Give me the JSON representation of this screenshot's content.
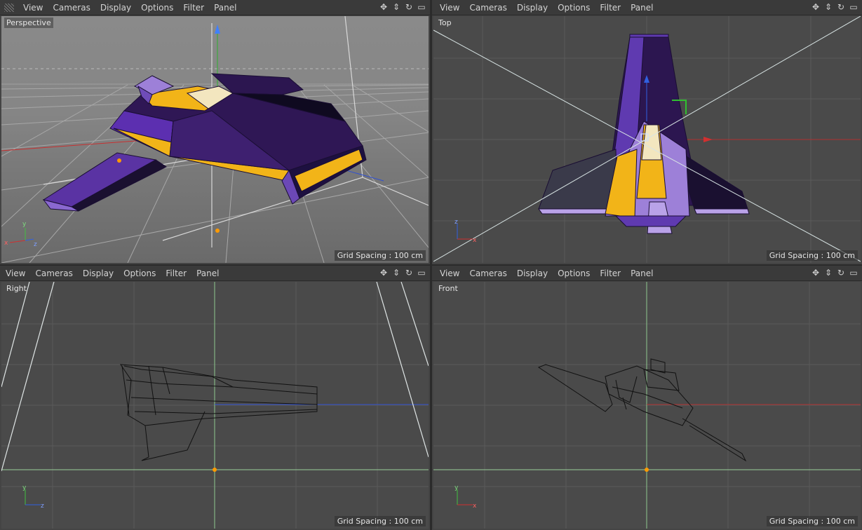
{
  "menu": [
    "View",
    "Cameras",
    "Display",
    "Options",
    "Filter",
    "Panel"
  ],
  "nav_icons": [
    "move-view-icon",
    "dolly-view-icon",
    "rotate-view-icon",
    "toggle-layout-icon"
  ],
  "viewports": {
    "perspective": {
      "label": "Perspective",
      "grid": "Grid Spacing : 100 cm",
      "axes": {
        "y": "y",
        "x": "x",
        "z": "z"
      }
    },
    "top": {
      "label": "Top",
      "grid": "Grid Spacing : 100 cm",
      "axes": {
        "v": "z",
        "h": "x"
      }
    },
    "right": {
      "label": "Right",
      "grid": "Grid Spacing : 100 cm",
      "axes": {
        "v": "y",
        "h": "z"
      }
    },
    "front": {
      "label": "Front",
      "grid": "Grid Spacing : 100 cm",
      "axes": {
        "v": "y",
        "h": "x"
      }
    }
  },
  "colors": {
    "ship_purple": "#3d1f6b",
    "ship_dark": "#120a24",
    "ship_light": "#9a7ad8",
    "ship_yellow": "#f2b418",
    "ship_cream": "#f0e2b4",
    "axis_x": "#d03030",
    "axis_y": "#40c040",
    "axis_z": "#3060e0"
  }
}
